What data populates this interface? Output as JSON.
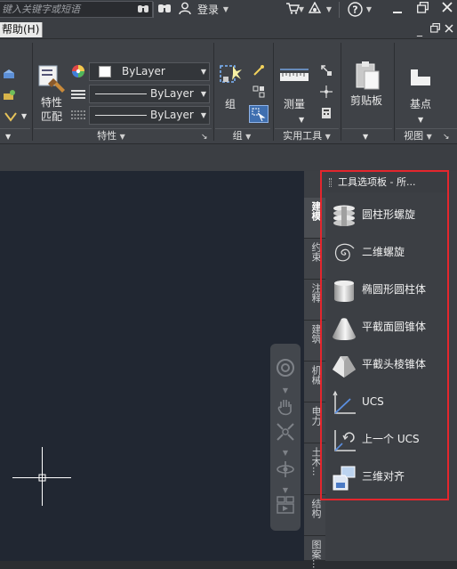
{
  "titlebar": {
    "search_placeholder": "键入关键字或短语",
    "login_label": "登录",
    "help_icon": "?"
  },
  "menubar": {
    "help_menu": "帮助(H)"
  },
  "ribbon": {
    "match_props_label_1": "特性",
    "match_props_label_2": "匹配",
    "bylayer_color": "ByLayer",
    "bylayer_linetype": "ByLayer",
    "bylayer_lineweight": "ByLayer",
    "panel_properties": "特性",
    "group_label": "组",
    "panel_group": "组",
    "measure_label": "测量",
    "panel_utilities": "实用工具",
    "clipboard_label": "剪贴板",
    "base_label": "基点",
    "panel_view": "视图"
  },
  "palette": {
    "header_title": "工具选项板 - 所...",
    "tabs": [
      "建模",
      "约束",
      "注释",
      "建筑",
      "机械",
      "电力",
      "土木...",
      "结构",
      "图案..."
    ],
    "items": [
      {
        "label": "圆柱形螺旋",
        "icon": "cylinder-helix-icon"
      },
      {
        "label": "二维螺旋",
        "icon": "2d-spiral-icon"
      },
      {
        "label": "椭圆形圆柱体",
        "icon": "elliptical-cylinder-icon"
      },
      {
        "label": "平截面圆锥体",
        "icon": "frustum-cone-icon"
      },
      {
        "label": "平截头棱锥体",
        "icon": "frustum-pyramid-icon"
      },
      {
        "label": "UCS",
        "icon": "ucs-icon"
      },
      {
        "label": "上一个 UCS",
        "icon": "previous-ucs-icon"
      },
      {
        "label": "三维对齐",
        "icon": "3d-align-icon"
      }
    ]
  },
  "colors": {
    "highlight": "#e4262d",
    "drawing_bg": "#212732",
    "ribbon_bg": "#3f4247"
  }
}
